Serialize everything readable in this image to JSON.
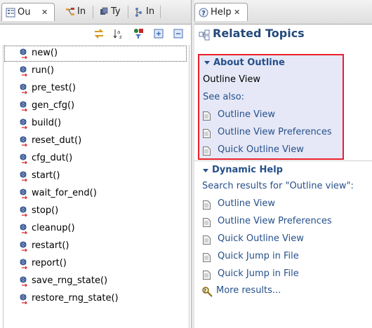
{
  "left_tabs": [
    {
      "label": "Ou",
      "icon": "outline-icon",
      "active": true
    },
    {
      "label": "In",
      "icon": "hierarchy-icon"
    },
    {
      "label": "Ty",
      "icon": "type-icon"
    },
    {
      "label": "In",
      "icon": "include-icon"
    }
  ],
  "left_toolbar": [
    "sync-icon",
    "sort-az-icon",
    "filter-icon",
    "expand-all-icon",
    "collapse-all-icon"
  ],
  "outline": {
    "items": [
      "new()",
      "run()",
      "pre_test()",
      "gen_cfg()",
      "build()",
      "reset_dut()",
      "cfg_dut()",
      "start()",
      "wait_for_end()",
      "stop()",
      "cleanup()",
      "restart()",
      "report()",
      "save_rng_state()",
      "restore_rng_state()"
    ]
  },
  "right_tab": {
    "label": "Help",
    "icon": "help-icon"
  },
  "help": {
    "title": "Related Topics",
    "about": {
      "heading": "About Outline",
      "subtitle": "Outline View",
      "see_also": "See also:",
      "links": [
        "Outline View",
        "Outline View Preferences",
        "Quick Outline View"
      ]
    },
    "dynamic": {
      "heading": "Dynamic Help",
      "search_text": "Search results for \"Outline view\":",
      "links": [
        "Outline View",
        "Outline View Preferences",
        "Quick Outline View",
        "Quick Jump in File",
        "Quick Jump in File"
      ],
      "more": "More results..."
    }
  },
  "colors": {
    "accent": "#25508a",
    "highlight_border": "#e8202a",
    "highlight_bg": "#e6e8f7"
  }
}
